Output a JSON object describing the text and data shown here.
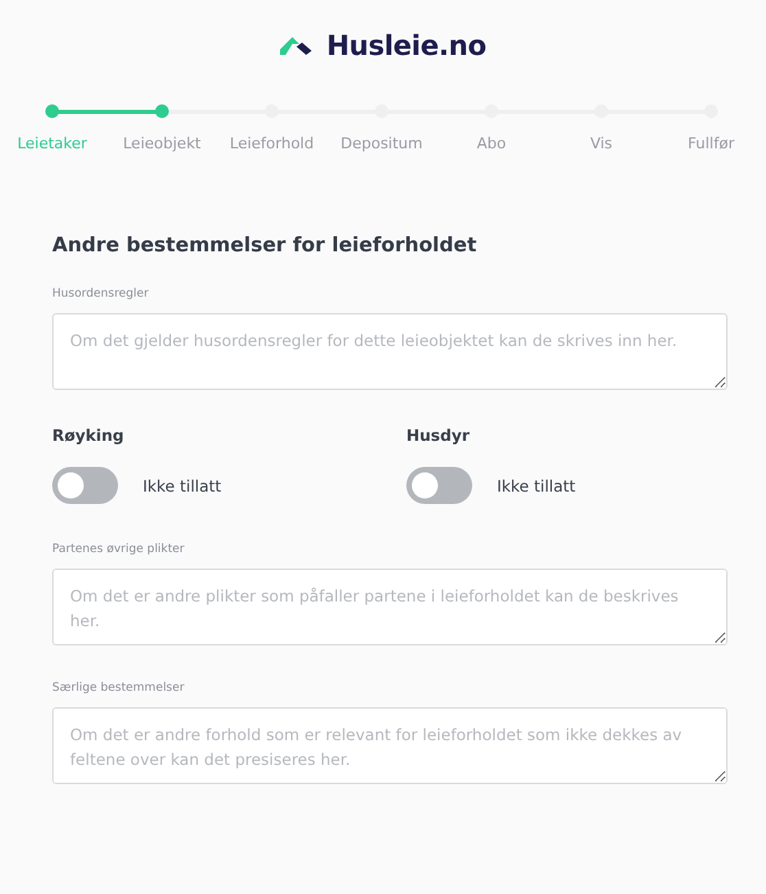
{
  "logo": {
    "text": "Husleie.no"
  },
  "steps": [
    {
      "label": "Leietaker",
      "completed": true,
      "selected": true
    },
    {
      "label": "Leieobjekt",
      "completed": true,
      "selected": false
    },
    {
      "label": "Leieforhold",
      "completed": false,
      "selected": false
    },
    {
      "label": "Depositum",
      "completed": false,
      "selected": false
    },
    {
      "label": "Abo",
      "completed": false,
      "selected": false
    },
    {
      "label": "Vis",
      "completed": false,
      "selected": false
    },
    {
      "label": "Fullfør",
      "completed": false,
      "selected": false
    }
  ],
  "form": {
    "title": "Andre bestemmelser for leieforholdet",
    "house_rules": {
      "label": "Husordensregler",
      "placeholder": "Om det gjelder husordensregler for dette leieobjektet kan de skrives inn her."
    },
    "toggles": [
      {
        "label": "Røyking",
        "on": false,
        "state_text": "Ikke tillatt"
      },
      {
        "label": "Husdyr",
        "on": false,
        "state_text": "Ikke tillatt"
      }
    ],
    "fields": [
      {
        "label": "Partenes øvrige plikter",
        "placeholder": "Om det er andre plikter som påfaller partene i leieforholdet kan de beskrives her."
      },
      {
        "label": "Særlige bestemmelser",
        "placeholder": "Om det er andre forhold som er relevant for leieforholdet som ikke dekkes av feltene over kan det presiseres her."
      }
    ]
  }
}
